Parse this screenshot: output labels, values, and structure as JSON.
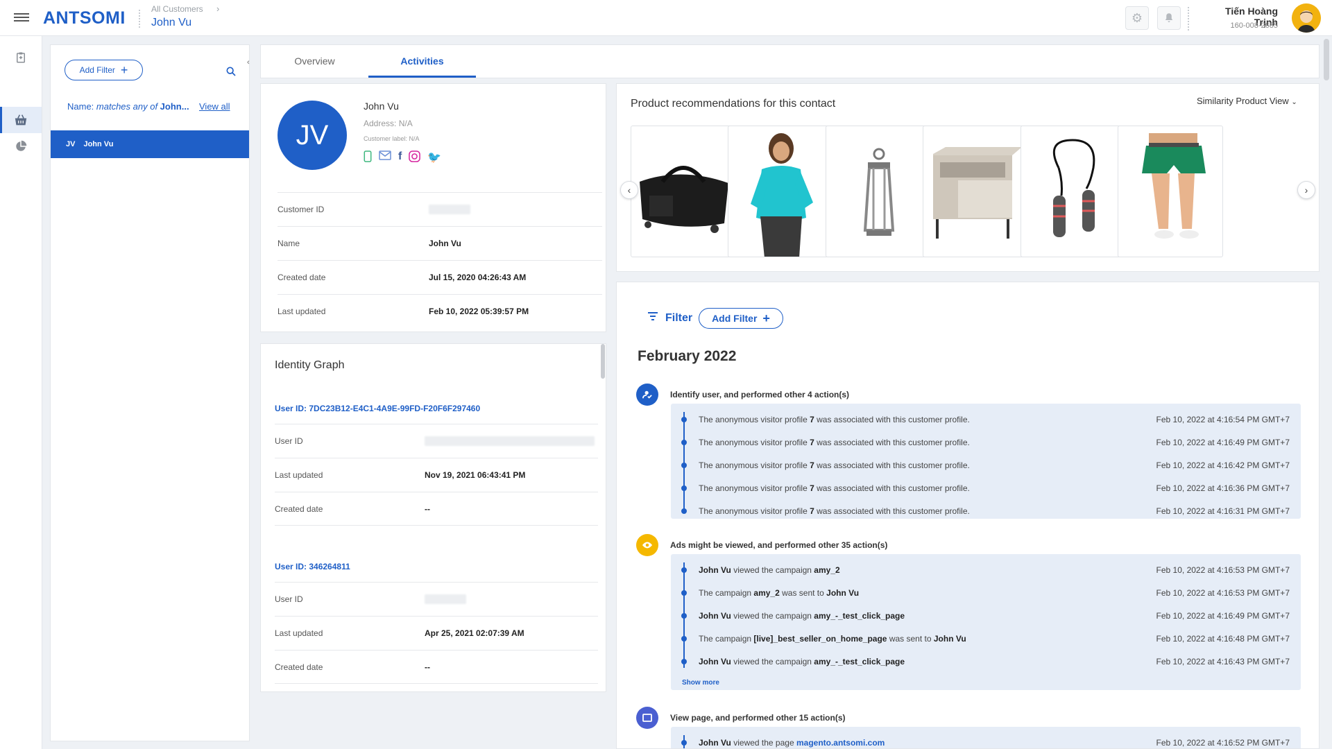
{
  "header": {
    "logo": "ANTSOMI",
    "breadcrumb": "All Customers",
    "page_title": "John Vu",
    "user_name": "Tiến Hoàng Trịnh",
    "user_phone": "160-008-2685"
  },
  "left_panel": {
    "add_filter": "Add Filter",
    "filter_label": "Name: ",
    "filter_condition": "matches any of",
    "filter_value": " John...",
    "view_all": "View all",
    "selected_initials": "JV",
    "selected_name": "John Vu"
  },
  "tabs": [
    "Overview",
    "Activities"
  ],
  "profile": {
    "initials": "JV",
    "name": "John Vu",
    "address": "Address: N/A",
    "label": "Customer label: N/A",
    "rows": [
      {
        "key": "Customer ID",
        "value": ""
      },
      {
        "key": "Name",
        "value": "John Vu"
      },
      {
        "key": "Created date",
        "value": "Jul 15, 2020 04:26:43 AM"
      },
      {
        "key": "Last updated",
        "value": "Feb 10, 2022 05:39:57 PM"
      }
    ]
  },
  "identity_graph": {
    "title": "Identity Graph",
    "blocks": [
      {
        "user_id": "User ID: 7DC23B12-E4C1-4A9E-99FD-F20F6F297460",
        "rows": [
          {
            "key": "User ID",
            "value": ""
          },
          {
            "key": "Last updated",
            "value": "Nov 19, 2021 06:43:41 PM"
          },
          {
            "key": "Created date",
            "value": "--"
          }
        ]
      },
      {
        "user_id": "User ID: 346264811",
        "rows": [
          {
            "key": "User ID",
            "value": ""
          },
          {
            "key": "Last updated",
            "value": "Apr 25, 2021 02:07:39 AM"
          },
          {
            "key": "Created date",
            "value": "--"
          }
        ]
      }
    ]
  },
  "recommendations": {
    "title": "Product recommendations for this contact",
    "view": "Similarity Product View",
    "products": [
      "duffel-bag",
      "teal-long-sleeve-top",
      "metal-lantern",
      "nightstand",
      "jump-rope",
      "green-shorts"
    ]
  },
  "activity": {
    "filter": "Filter",
    "add_filter": "Add Filter",
    "month": "February 2022",
    "colors": {
      "identify": "#1f5fc7",
      "ads": "#f5b800",
      "view": "#4a5fd1"
    },
    "groups": [
      {
        "title": "Identify user, and performed other 4 action(s)",
        "events": [
          {
            "pre": "The anonymous visitor profile ",
            "b1": "7",
            "mid": " was associated with this customer profile.",
            "b2": "",
            "post": "",
            "time": "Feb 10, 2022 at 4:16:54 PM GMT+7"
          },
          {
            "pre": "The anonymous visitor profile ",
            "b1": "7",
            "mid": " was associated with this customer profile.",
            "b2": "",
            "post": "",
            "time": "Feb 10, 2022 at 4:16:49 PM GMT+7"
          },
          {
            "pre": "The anonymous visitor profile ",
            "b1": "7",
            "mid": " was associated with this customer profile.",
            "b2": "",
            "post": "",
            "time": "Feb 10, 2022 at 4:16:42 PM GMT+7"
          },
          {
            "pre": "The anonymous visitor profile ",
            "b1": "7",
            "mid": " was associated with this customer profile.",
            "b2": "",
            "post": "",
            "time": "Feb 10, 2022 at 4:16:36 PM GMT+7"
          },
          {
            "pre": "The anonymous visitor profile ",
            "b1": "7",
            "mid": " was associated with this customer profile.",
            "b2": "",
            "post": "",
            "time": "Feb 10, 2022 at 4:16:31 PM GMT+7"
          }
        ]
      },
      {
        "title": "Ads might be viewed, and performed other 35 action(s)",
        "show_more": "Show more",
        "events": [
          {
            "pre": "",
            "b1": "John Vu",
            "mid": " viewed the campaign ",
            "b2": "amy_2",
            "post": "",
            "time": "Feb 10, 2022 at 4:16:53 PM GMT+7"
          },
          {
            "pre": "The campaign ",
            "b1": "amy_2",
            "mid": " was sent to ",
            "b2": "John Vu",
            "post": "",
            "time": "Feb 10, 2022 at 4:16:53 PM GMT+7"
          },
          {
            "pre": "",
            "b1": "John Vu",
            "mid": " viewed the campaign ",
            "b2": "amy_-_test_click_page",
            "post": "",
            "time": "Feb 10, 2022 at 4:16:49 PM GMT+7"
          },
          {
            "pre": "The campaign ",
            "b1": "[live]_best_seller_on_home_page",
            "mid": " was sent to ",
            "b2": "John Vu",
            "post": "",
            "time": "Feb 10, 2022 at 4:16:48 PM GMT+7"
          },
          {
            "pre": "",
            "b1": "John Vu",
            "mid": " viewed the campaign ",
            "b2": "amy_-_test_click_page",
            "post": "",
            "time": "Feb 10, 2022 at 4:16:43 PM GMT+7"
          }
        ]
      },
      {
        "title": "View page, and performed other 15 action(s)",
        "events": [
          {
            "pre": "",
            "b1": "John Vu",
            "mid": " viewed the page ",
            "b2": "magento.antsomi.com",
            "post": "",
            "time": "Feb 10, 2022 at 4:16:52 PM GMT+7"
          }
        ]
      }
    ]
  }
}
